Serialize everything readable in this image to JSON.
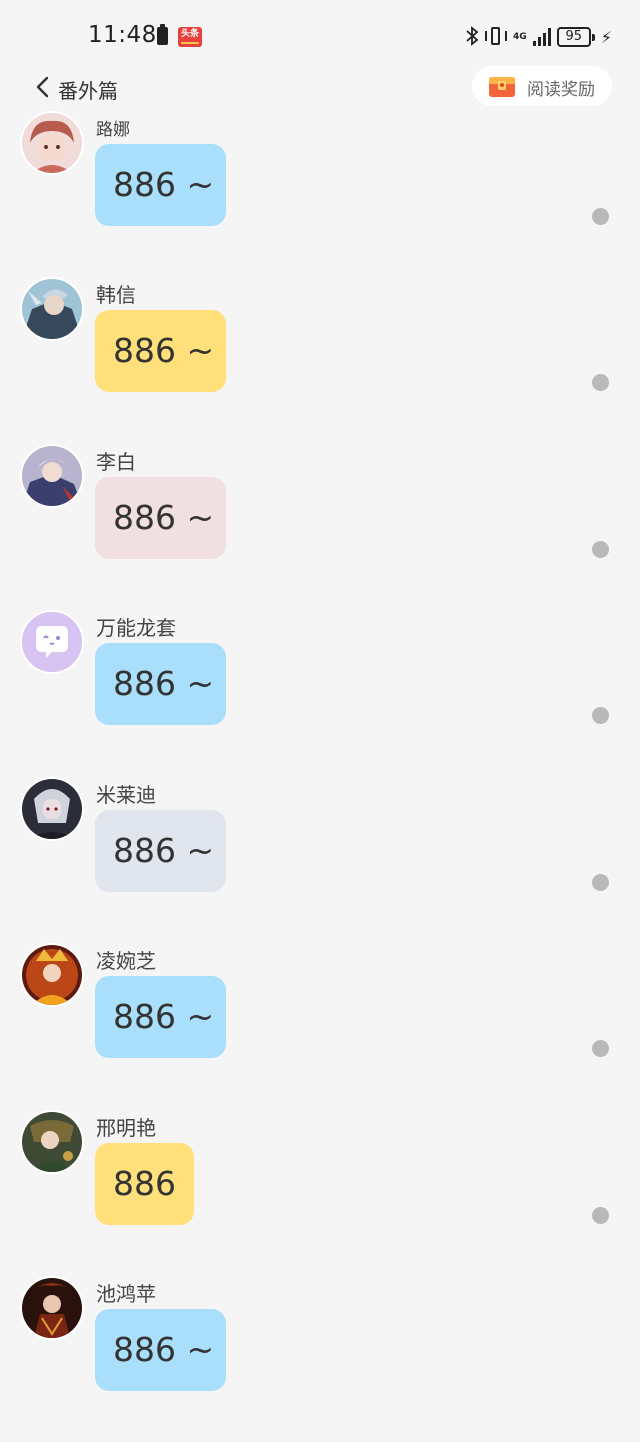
{
  "status_bar": {
    "time": "11:48",
    "news_badge": "头条",
    "network": "4G",
    "battery": "95"
  },
  "header": {
    "back_icon": "chevron-left-icon",
    "title": "番外篇",
    "reward_label": "阅读奖励",
    "reward_icon": "gift-box-icon"
  },
  "messages": [
    {
      "sender": "路娜",
      "text": "886 ~",
      "bubble_color": "#a9dffb",
      "avatar_color": "#e9c6c4"
    },
    {
      "sender": "韩信",
      "text": "886 ~",
      "bubble_color": "#ffe07a",
      "avatar_color": "#5a7a90"
    },
    {
      "sender": "李白",
      "text": "886 ~",
      "bubble_color": "#f1e0e1",
      "avatar_color": "#8a86a8"
    },
    {
      "sender": "万能龙套",
      "text": "886 ~",
      "bubble_color": "#a9dffb",
      "avatar_color": "#d7c4f3"
    },
    {
      "sender": "米莱迪",
      "text": "886 ~",
      "bubble_color": "#e1e6ee",
      "avatar_color": "#3c3f4c"
    },
    {
      "sender": "凌婉芝",
      "text": "886 ~",
      "bubble_color": "#a9dffb",
      "avatar_color": "#c0451f"
    },
    {
      "sender": "邢明艳",
      "text": "886",
      "bubble_color": "#ffe07a",
      "avatar_color": "#4f5d3d"
    },
    {
      "sender": "池鸿苹",
      "text": "886 ~",
      "bubble_color": "#a9dffb",
      "avatar_color": "#6b2c1c"
    }
  ]
}
